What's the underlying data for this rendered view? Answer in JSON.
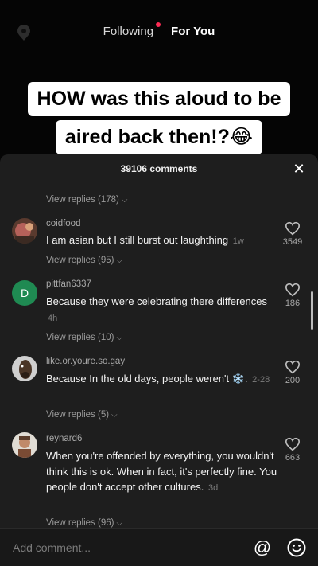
{
  "top": {
    "tab_following": "Following",
    "tab_foryou": "For You",
    "live_icon": "live-icon"
  },
  "caption": {
    "line1": "HOW was this aloud to be",
    "line2": "aired back then!?😂"
  },
  "sheet": {
    "title": "39106 comments",
    "close_icon": "close-icon",
    "replies_top": "View replies (178)",
    "comments": [
      {
        "username": "coidfood",
        "text": "I am asian but I still burst out laughthing",
        "time": "1w",
        "likes": "3549",
        "replies": "View replies (95)"
      },
      {
        "username": "pittfan6337",
        "avatar_letter": "D",
        "text": "Because they were celebrating there differences",
        "time": "4h",
        "likes": "186",
        "replies": "View replies (10)"
      },
      {
        "username": "like.or.youre.so.gay",
        "text": "Because In the old days, people weren't ❄️.",
        "time": "2-28",
        "likes": "200",
        "replies": "View replies (5)"
      },
      {
        "username": "reynard6",
        "text": "When you're offended by everything, you wouldn't think this is ok. When in fact, it's perfectly fine. You people don't accept other cultures.",
        "time": "3d",
        "likes": "663",
        "replies": "View replies (96)"
      }
    ]
  },
  "add_bar": {
    "placeholder": "Add comment...",
    "at_icon": "at-icon",
    "emoji_icon": "emoji-icon"
  },
  "colors": {
    "accent": "#fe2c55",
    "sheet_bg": "#1e1e1e",
    "muted_text": "#a8a8a8"
  }
}
